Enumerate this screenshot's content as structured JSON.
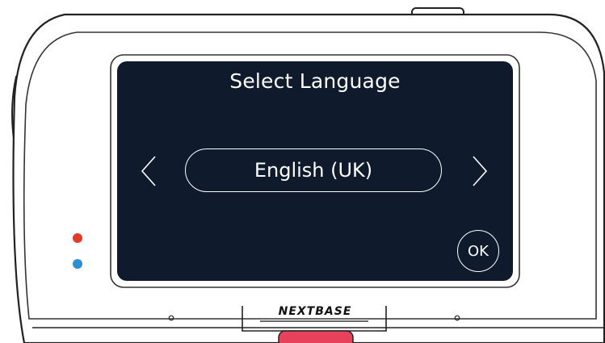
{
  "screen": {
    "title": "Select Language",
    "selected_language": "English (UK)",
    "ok_label": "OK"
  },
  "device": {
    "brand": "NEXTBASE",
    "colors": {
      "screen": "#0f1b2d",
      "led_red": "#e03c2c",
      "led_blue": "#2c8fd6",
      "record_button": "#e8415b"
    }
  },
  "icons": {
    "prev": "chevron-left-icon",
    "next": "chevron-right-icon"
  }
}
